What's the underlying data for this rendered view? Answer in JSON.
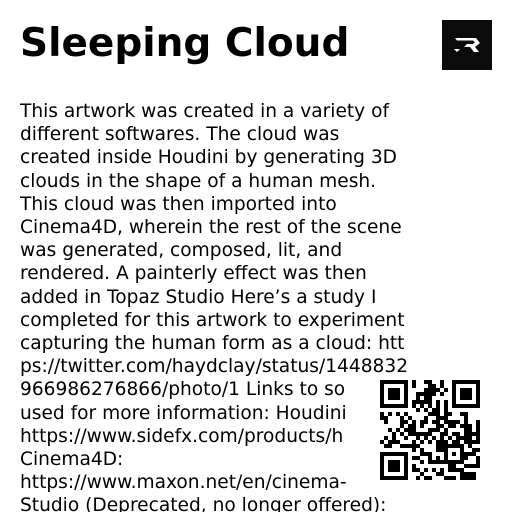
{
  "artwork": {
    "title": "Sleeping Cloud",
    "description_lines": [
      "This artwork was created in a variety of",
      "different softwares. The cloud was",
      "created inside Houdini by generating 3D",
      "clouds in the shape of a human mesh.",
      "This cloud was then imported into",
      "Cinema4D, wherein the rest of the scene",
      "was generated, composed, lit, and",
      "rendered. A painterly effect was then",
      "added in Topaz Studio Here’s a study I",
      "completed for this artwork to experiment",
      "capturing the human form as a cloud: htt",
      "ps://twitter.com/haydclay/status/1448832",
      "966986276866/photo/1 Links to so",
      "used for more information: Houdini",
      "https://www.sidefx.com/products/h",
      "Cinema4D:",
      "https://www.maxon.net/en/cinema-",
      "Studio (Deprecated, no longer offered):"
    ]
  },
  "icons": {
    "logo": "brand-logo-icon",
    "qr": "qr-code-icon"
  },
  "colors": {
    "background": "#ffffff",
    "text": "#000000",
    "logo_background": "#0b0b0b",
    "logo_foreground": "#ffffff"
  }
}
